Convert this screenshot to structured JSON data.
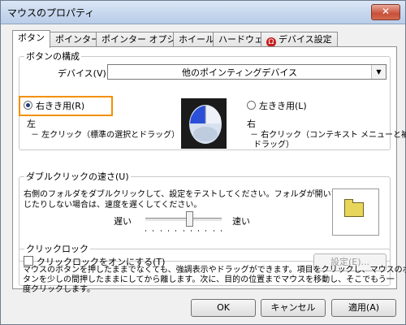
{
  "window": {
    "title": "マウスのプロパティ",
    "close_glyph": "✕"
  },
  "tabs": [
    {
      "label": "ボタン"
    },
    {
      "label": "ポインター"
    },
    {
      "label": "ポインター オプション"
    },
    {
      "label": "ホイール"
    },
    {
      "label": "ハードウェア"
    },
    {
      "label": "デバイス設定",
      "icon": "device-settings-icon"
    }
  ],
  "button_config": {
    "legend": "ボタンの構成",
    "device_label": "デバイス(V):",
    "device_value": "他のポインティングデバイス",
    "right_handed_label": "右きき用(R)",
    "left_handed_label": "左きき用(L)",
    "left_heading": "左",
    "left_desc": "－ 左クリック（標準の選択とドラッグ）",
    "right_heading": "右",
    "right_desc_line1": "－ 右クリック（コンテキスト メニューと補助",
    "right_desc_line2": "ドラッグ）",
    "right_handed_selected": true
  },
  "double_click": {
    "legend": "ダブルクリックの速さ(U)",
    "desc_line1": "右側のフォルダをダブルクリックして、設定をテストしてください。フォルダが開いたり閉",
    "desc_line2": "じたりしない場合は、速度を遅くしてください。",
    "slow_label": "遅い",
    "fast_label": "速い",
    "speed_fraction": 0.57,
    "tick_count": 11
  },
  "click_lock": {
    "legend": "クリックロック",
    "checkbox_label": "クリックロックをオンにする(T)",
    "checked": false,
    "settings_button": "設定(E)...",
    "desc_line1": "マウスのボタンを押したままでなくても、強調表示やドラッグができます。項目をクリックし、マウスのボ",
    "desc_line2": "タンを少しの間押したままにしてから離します。次に、目的の位置までマウスを移動し、そこでもう一",
    "desc_line3": "度クリックします。"
  },
  "footer": {
    "ok": "OK",
    "cancel": "キャンセル",
    "apply": "適用(A)"
  },
  "colors": {
    "highlight": "#f39000"
  }
}
